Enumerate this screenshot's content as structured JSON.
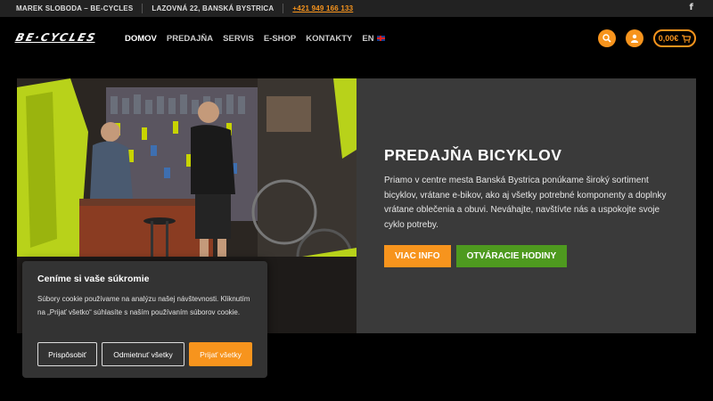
{
  "topbar": {
    "name": "MAREK SLOBODA – BE-CYCLES",
    "address": "LAZOVNÁ 22, BANSKÁ BYSTRICA",
    "phone": "+421 949 166 133",
    "social_icon": "facebook-icon"
  },
  "header": {
    "logo_text": "BE·CYCLES",
    "nav": [
      "DOMOV",
      "PREDAJŇA",
      "SERVIS",
      "E-SHOP",
      "KONTAKTY",
      "EN"
    ],
    "active_nav": "DOMOV",
    "cart_total": "0,00€",
    "icons": [
      "search-icon",
      "user-icon",
      "cart-icon"
    ]
  },
  "hero": {
    "title": "PREDAJŇA BICYKLOV",
    "text": "Priamo v centre mesta Banská Bystrica ponúkame široký sortiment bicyklov, vrátane e-bikov, ako aj všetky potrebné komponenty a doplnky vrátane oblečenia a obuvi. Neváhajte, navštívte nás a uspokojte svoje cyklo potreby.",
    "button_info": "VIAC INFO",
    "button_hours": "OTVÁRACIE HODINY"
  },
  "cookie": {
    "title": "Ceníme si vaše súkromie",
    "text": "Súbory cookie používame na analýzu našej návštevnosti. Kliknutím na „Prijať všetko“ súhlasíte s naším používaním súborov cookie.",
    "customize": "Prispôsobiť",
    "reject": "Odmietnuť všetky",
    "accept": "Prijať všetky"
  },
  "colors": {
    "accent": "#f7941d",
    "green": "#4e9a1f",
    "panel": "#3a3a3a",
    "topbar": "#222222"
  }
}
